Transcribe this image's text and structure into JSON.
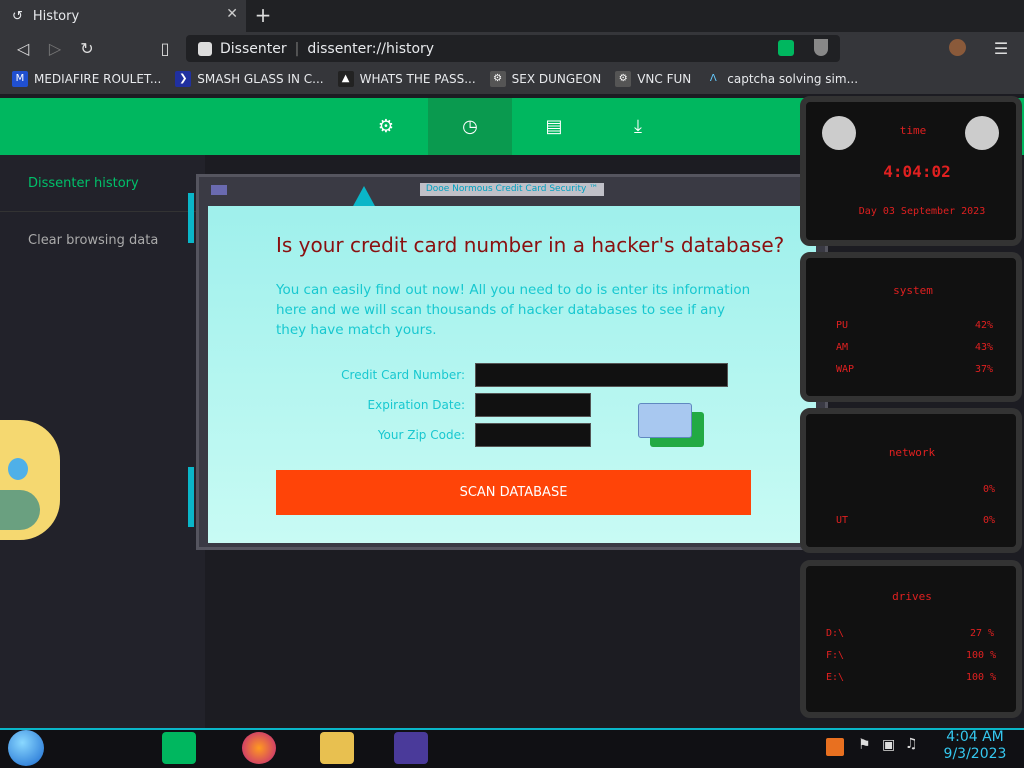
{
  "browser": {
    "tab_title": "History",
    "site_name": "Dissenter",
    "url": "dissenter://history",
    "bookmarks": [
      {
        "label": "MEDIAFIRE ROULET...",
        "icon": "mediafire-icon"
      },
      {
        "label": "SMASH GLASS IN C...",
        "icon": "smash-icon"
      },
      {
        "label": "WHATS THE PASS...",
        "icon": "pass-icon"
      },
      {
        "label": "SEX DUNGEON",
        "icon": "dungeon-icon"
      },
      {
        "label": "VNC FUN",
        "icon": "vnc-icon"
      },
      {
        "label": "captcha solving sim...",
        "icon": "captcha-icon"
      }
    ]
  },
  "sidebar": {
    "items": [
      {
        "label": "Dissenter history"
      },
      {
        "label": "Clear browsing data"
      }
    ]
  },
  "popup": {
    "window_title": "Dooe Normous Credit Card Security ™",
    "heading": "Is your credit card number in a hacker's database?",
    "description": "You can easily find out now! All you need to do is enter its information here and we will scan thousands of hacker databases to see if any they have match yours.",
    "fields": {
      "card_number_label": "Credit Card Number:",
      "expiration_label": "Expiration Date:",
      "zip_label": "Your Zip Code:"
    },
    "scan_button": "SCAN DATABASE"
  },
  "widgets": {
    "time_title": "time",
    "time": "4:04:02",
    "date": "Day 03 September 2023",
    "system_title": "system",
    "cpu_label": "PU",
    "cpu_value": "42%",
    "ram_label": "AM",
    "ram_value": "43%",
    "swap_label": "WAP",
    "swap_value": "37%",
    "network_title": "network",
    "net_in_value": "0%",
    "net_out_label": "UT",
    "net_out_value": "0%",
    "drives_title": "drives",
    "drives": [
      {
        "label": "D:\\",
        "value": "27 %"
      },
      {
        "label": "F:\\",
        "value": "100 %"
      },
      {
        "label": "E:\\",
        "value": "100 %"
      }
    ]
  },
  "taskbar": {
    "time": "4:04 AM",
    "date": "9/3/2023"
  },
  "colors": {
    "accent_green": "#00b75f",
    "scan_button": "#ff4408",
    "heading": "#8a1010",
    "cyan_text": "#18c8d0"
  }
}
